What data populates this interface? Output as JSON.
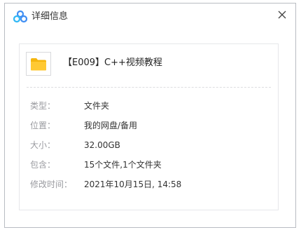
{
  "window": {
    "title": "详细信息"
  },
  "file": {
    "name": "【E009】C++视频教程"
  },
  "details": [
    {
      "label": "类型：",
      "value": "文件夹"
    },
    {
      "label": "位置：",
      "value": "我的网盘/备用"
    },
    {
      "label": "大小：",
      "value": "32.00GB"
    },
    {
      "label": "包含：",
      "value": "15个文件,1个文件夹"
    },
    {
      "label": "修改时间：",
      "value": "2021年10月15日, 14:58"
    }
  ],
  "icons": {
    "app": "baidu-netdisk-cloud-icon",
    "close": "close-icon",
    "file": "folder-icon"
  },
  "colors": {
    "app_icon_blue": "#3f8ef3",
    "folder_yellow": "#ffc933",
    "folder_tab": "#f5b60f"
  }
}
